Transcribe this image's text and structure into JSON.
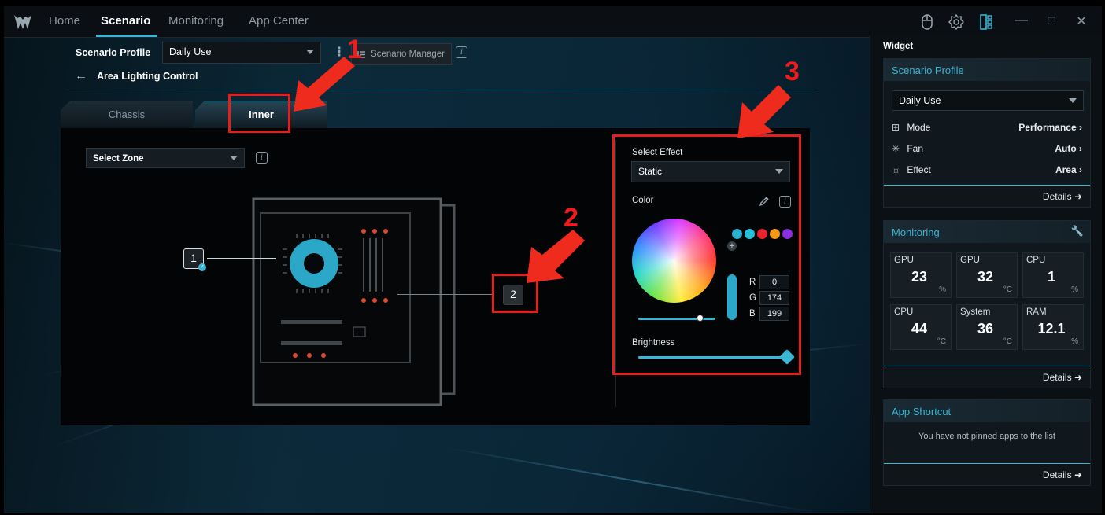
{
  "nav": {
    "items": [
      "Home",
      "Scenario",
      "Monitoring",
      "App Center"
    ],
    "active": "Scenario"
  },
  "window_controls": [
    "minimize",
    "maximize",
    "close"
  ],
  "scenario": {
    "profile_label": "Scenario Profile",
    "profile_value": "Daily Use",
    "manager_label": "Scenario Manager",
    "back_title": "Area Lighting Control"
  },
  "tabs": [
    "Chassis",
    "Inner"
  ],
  "active_tab": "Inner",
  "zone": {
    "select_label": "Select Zone",
    "zones": [
      "1",
      "2"
    ]
  },
  "effect": {
    "select_label": "Select Effect",
    "value": "Static",
    "color_label": "Color",
    "presets": [
      "#2bb0cf",
      "#26c0d8",
      "#e8242e",
      "#f39a1a",
      "#8b2ee0"
    ],
    "rgb": {
      "r_label": "R",
      "r": "0",
      "g_label": "G",
      "g": "174",
      "b_label": "B",
      "b": "199"
    },
    "brightness_label": "Brightness",
    "brightness": 1.0,
    "saturation": 0.8
  },
  "annotations": [
    "1",
    "2",
    "3"
  ],
  "sidebar": {
    "title": "Widget",
    "scenario_card": {
      "title": "Scenario Profile",
      "profile": "Daily Use",
      "rows": [
        {
          "label": "Mode",
          "value": "Performance",
          "icon": "mode-icon"
        },
        {
          "label": "Fan",
          "value": "Auto",
          "icon": "fan-icon"
        },
        {
          "label": "Effect",
          "value": "Area",
          "icon": "effect-icon"
        }
      ],
      "details": "Details"
    },
    "monitoring_card": {
      "title": "Monitoring",
      "tiles": [
        {
          "label": "GPU",
          "value": "23",
          "unit": "%"
        },
        {
          "label": "GPU",
          "value": "32",
          "unit": "°C"
        },
        {
          "label": "CPU",
          "value": "1",
          "unit": "%"
        },
        {
          "label": "CPU",
          "value": "44",
          "unit": "°C"
        },
        {
          "label": "System",
          "value": "36",
          "unit": "°C"
        },
        {
          "label": "RAM",
          "value": "12.1",
          "unit": "%"
        }
      ],
      "details": "Details"
    },
    "shortcut_card": {
      "title": "App Shortcut",
      "message": "You have not pinned apps to the list",
      "details": "Details"
    }
  }
}
